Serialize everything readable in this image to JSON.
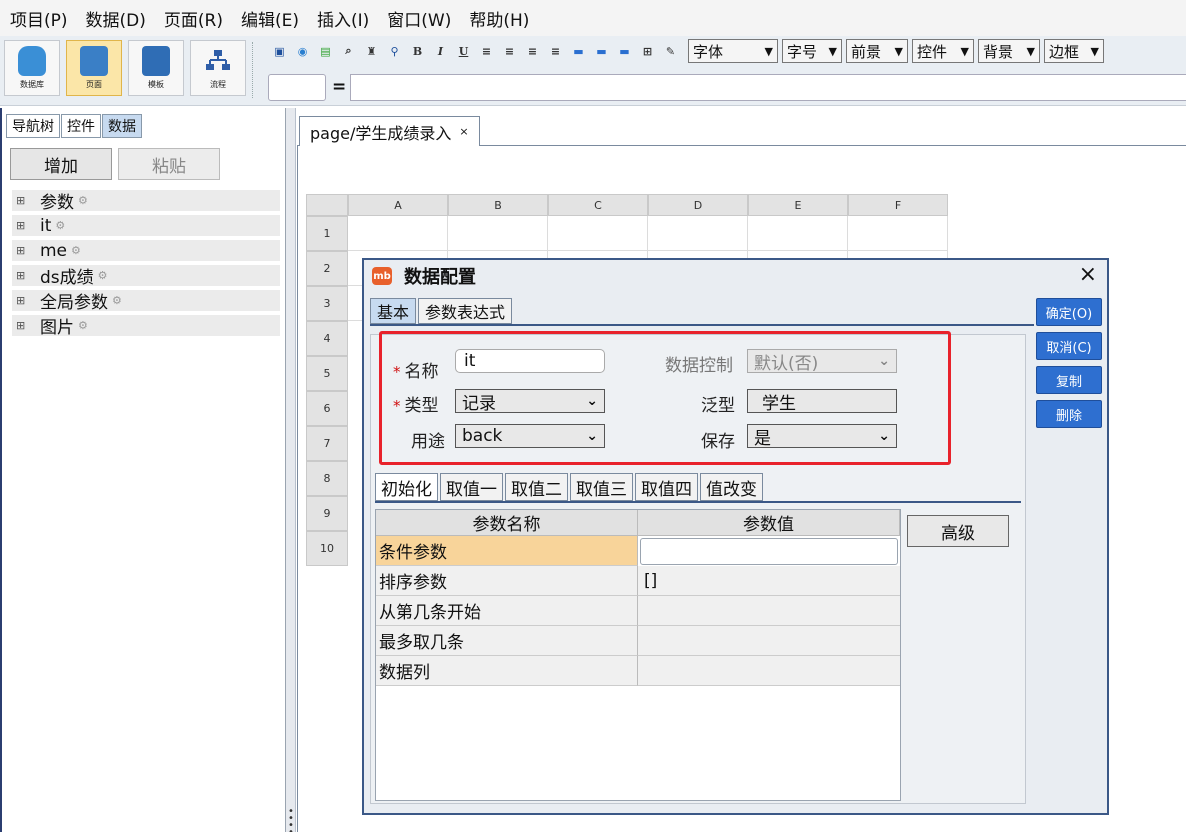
{
  "menu": [
    "项目(P)",
    "数据(D)",
    "页面(R)",
    "编辑(E)",
    "插入(I)",
    "窗口(W)",
    "帮助(H)"
  ],
  "toolbar": {
    "big_buttons": [
      "数据库",
      "页面",
      "模板",
      "流程"
    ],
    "format_buttons": [
      "B",
      "I",
      "U"
    ],
    "combos": [
      "字体",
      "字号",
      "前景",
      "控件",
      "背景",
      "边框"
    ],
    "formula_eq": "="
  },
  "left_panel": {
    "tabs": [
      "导航树",
      "控件",
      "数据"
    ],
    "add_label": "增加",
    "paste_label": "粘贴",
    "tree": [
      "参数",
      "it",
      "me",
      "ds成绩",
      "全局参数",
      "图片"
    ]
  },
  "editor": {
    "tab_title": "page/学生成绩录入",
    "tab_close": "×",
    "columns": [
      "A",
      "B",
      "C",
      "D",
      "E",
      "F"
    ],
    "rows": [
      "1",
      "2",
      "3",
      "4",
      "5",
      "6",
      "7",
      "8",
      "9",
      "10"
    ]
  },
  "dialog": {
    "logo": "mb",
    "title": "数据配置",
    "close": "×",
    "tabs": [
      "基本",
      "参数表达式"
    ],
    "side_buttons": [
      "确定(O)",
      "取消(C)",
      "复制",
      "删除"
    ],
    "fields": {
      "name_label": "名称",
      "name_value": "it",
      "type_label": "类型",
      "type_value": "记录",
      "usage_label": "用途",
      "usage_value": "back",
      "datactl_label": "数据控制",
      "datactl_value": "默认(否)",
      "generic_label": "泛型",
      "generic_value": "学生",
      "save_label": "保存",
      "save_value": "是",
      "required_mark": "*"
    },
    "subtabs": [
      "初始化",
      "取值一",
      "取值二",
      "取值三",
      "取值四",
      "值改变"
    ],
    "param_table": {
      "headers": [
        "参数名称",
        "参数值"
      ],
      "rows": [
        {
          "name": "条件参数",
          "value": ""
        },
        {
          "name": "排序参数",
          "value": "[]"
        },
        {
          "name": "从第几条开始",
          "value": ""
        },
        {
          "name": "最多取几条",
          "value": ""
        },
        {
          "name": "数据列",
          "value": ""
        }
      ]
    },
    "advanced_label": "高级"
  }
}
